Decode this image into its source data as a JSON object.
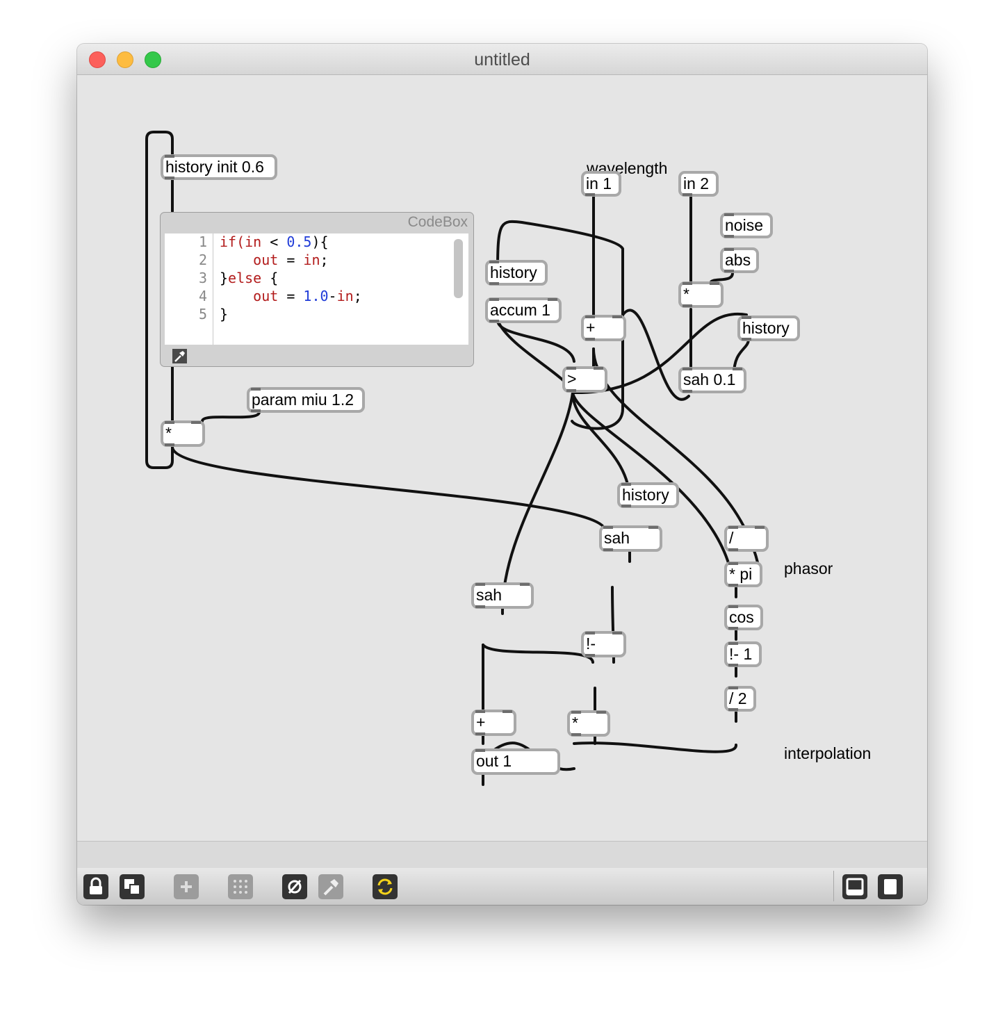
{
  "window": {
    "title": "untitled"
  },
  "labels": {
    "wavelength": "wavelength",
    "phasor": "phasor",
    "interpolation": "interpolation"
  },
  "objects": {
    "history_init": "history init 0.6",
    "param_miu": "param miu 1.2",
    "mult_left": "*",
    "in1": "in 1",
    "in2": "in 2",
    "noise": "noise",
    "abs": "abs",
    "mult_in2": "*",
    "history_accum": "history",
    "accum": "accum 1",
    "plus": "+",
    "history_right": "history",
    "greater": ">",
    "sah01": "sah 0.1",
    "history_mid": "history",
    "sah_mid": "sah",
    "divide": "/",
    "mult_pi": "* pi",
    "cos": "cos",
    "rsub1": "!- 1",
    "div2": "/ 2",
    "sah_left": "sah",
    "rsub": "!-",
    "plus_out": "+",
    "mult_out": "*",
    "out1": "out 1"
  },
  "codebox": {
    "title": "CodeBox",
    "line_numbers": [
      "1",
      "2",
      "3",
      "4",
      "5"
    ]
  },
  "toolbar": {
    "icons": [
      "lock-icon",
      "presentation-icon",
      "add-object-icon",
      "grid-icon",
      "mute-audio-icon",
      "build-hammer-icon",
      "refresh-icon",
      "bottom-panel-icon",
      "right-panel-icon"
    ]
  }
}
